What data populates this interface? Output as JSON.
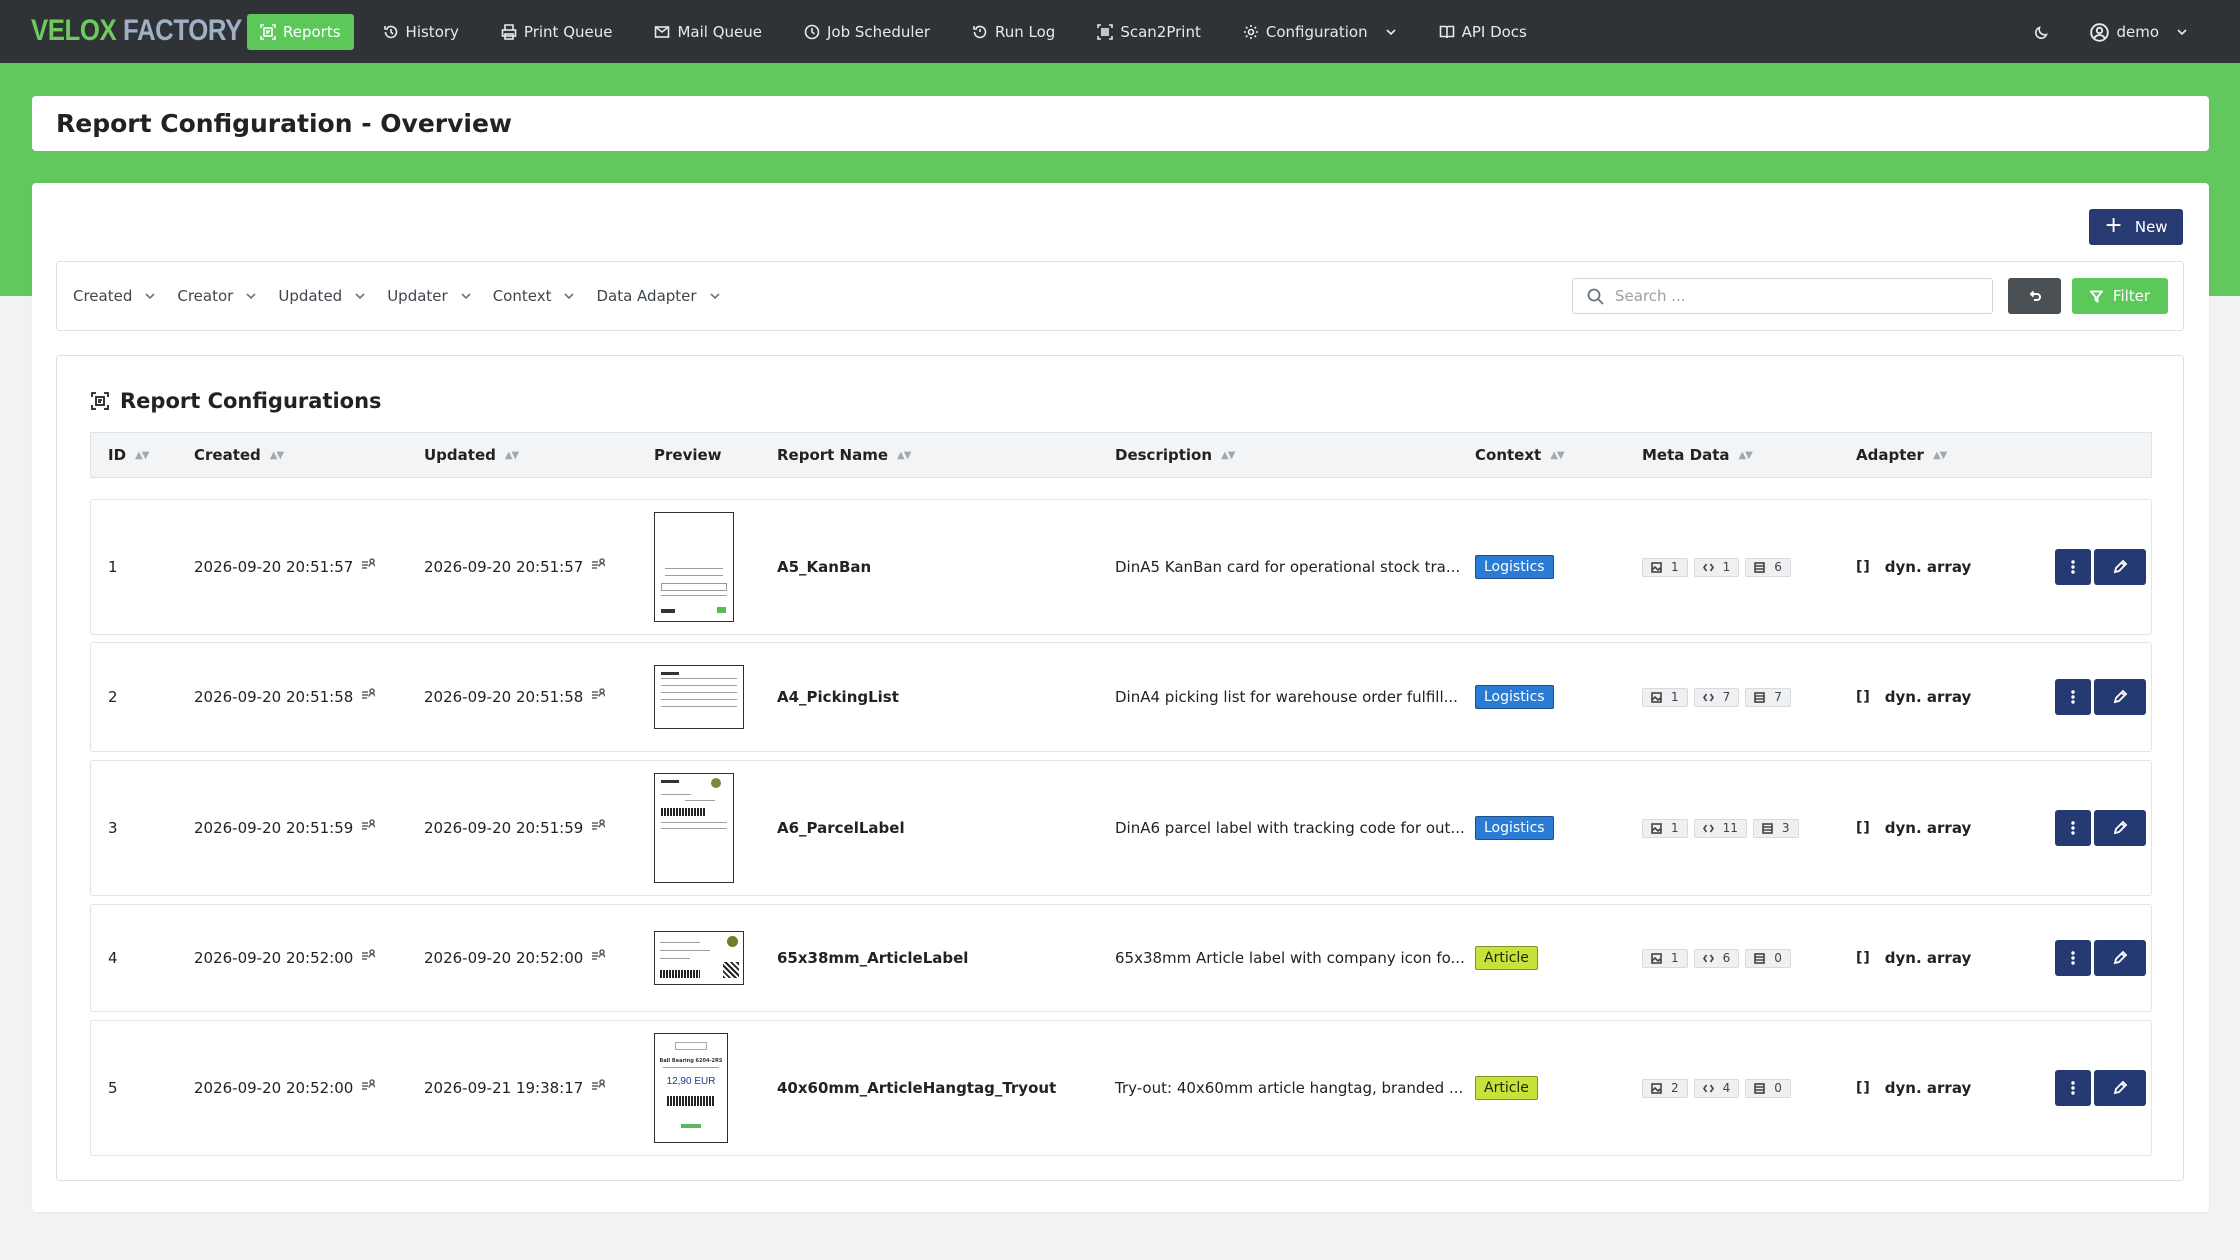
{
  "brand": {
    "part1": "VELOX",
    "part2": "FACTORY"
  },
  "nav": {
    "items": [
      {
        "label": "Reports",
        "icon": "reports-icon",
        "active": true
      },
      {
        "label": "History",
        "icon": "history-icon"
      },
      {
        "label": "Print Queue",
        "icon": "printer-icon"
      },
      {
        "label": "Mail Queue",
        "icon": "mail-icon"
      },
      {
        "label": "Job Scheduler",
        "icon": "clock-icon"
      },
      {
        "label": "Run Log",
        "icon": "run-log-icon"
      },
      {
        "label": "Scan2Print",
        "icon": "barcode-scan-icon"
      },
      {
        "label": "Configuration",
        "icon": "gear-icon"
      },
      {
        "label": "API Docs",
        "icon": "book-icon"
      }
    ],
    "user": "demo"
  },
  "page": {
    "title": "Report Configuration - Overview"
  },
  "toolbar": {
    "new_label": "New"
  },
  "filters": {
    "items": [
      "Created",
      "Creator",
      "Updated",
      "Updater",
      "Context",
      "Data Adapter"
    ],
    "search_placeholder": "Search ...",
    "filter_label": "Filter"
  },
  "table": {
    "title": "Report Configurations",
    "columns": [
      "ID",
      "Created",
      "Updated",
      "Preview",
      "Report Name",
      "Description",
      "Context",
      "Meta Data",
      "Adapter"
    ],
    "rows": [
      {
        "id": "1",
        "created": "2026-09-20 20:51:57",
        "updated": "2026-09-20 20:51:57",
        "name": "A5_KanBan",
        "description": "DinA5 KanBan card for operational stock tra...",
        "context": "Logistics",
        "meta": [
          "1",
          "1",
          "6"
        ],
        "adapter": "dyn. array"
      },
      {
        "id": "2",
        "created": "2026-09-20 20:51:58",
        "updated": "2026-09-20 20:51:58",
        "name": "A4_PickingList",
        "description": "DinA4 picking list for warehouse order fulfill...",
        "context": "Logistics",
        "meta": [
          "1",
          "7",
          "7"
        ],
        "adapter": "dyn. array"
      },
      {
        "id": "3",
        "created": "2026-09-20 20:51:59",
        "updated": "2026-09-20 20:51:59",
        "name": "A6_ParcelLabel",
        "description": "DinA6 parcel label with tracking code for out...",
        "context": "Logistics",
        "meta": [
          "1",
          "11",
          "3"
        ],
        "adapter": "dyn. array"
      },
      {
        "id": "4",
        "created": "2026-09-20 20:52:00",
        "updated": "2026-09-20 20:52:00",
        "name": "65x38mm_ArticleLabel",
        "description": "65x38mm Article label with company icon fo...",
        "context": "Article",
        "meta": [
          "1",
          "6",
          "0"
        ],
        "adapter": "dyn. array"
      },
      {
        "id": "5",
        "created": "2026-09-20 20:52:00",
        "updated": "2026-09-21 19:38:17",
        "name": "40x60mm_ArticleHangtag_Tryout",
        "description": "Try-out: 40x60mm article hangtag, branded ...",
        "context": "Article",
        "meta": [
          "2",
          "4",
          "0"
        ],
        "adapter": "dyn. array"
      }
    ],
    "thumb5": {
      "title": "Ball Bearing 6204-2RS",
      "price": "12,90 EUR"
    }
  },
  "colors": {
    "accent": "#5cc85a",
    "navbar": "#2f3336",
    "primary_button": "#253a72",
    "logistics": "#2a7bd3",
    "article": "#c7e23a"
  }
}
